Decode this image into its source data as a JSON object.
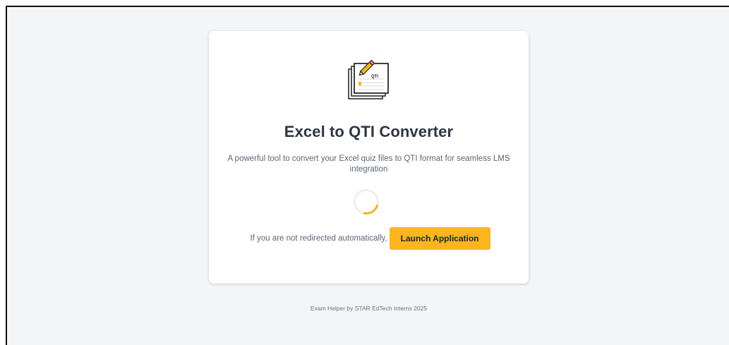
{
  "app": {
    "title": "Excel to QTI Converter",
    "subtitle": "A powerful tool to convert your Excel quiz files to QTI format for seamless LMS integration",
    "logo_icon": "qti-document-stack-icon",
    "logo_label": "QTI"
  },
  "redirect": {
    "message": "If you are not redirected automatically,",
    "button_label": "Launch Application"
  },
  "loading": {
    "spinner_icon": "loading-spinner-icon"
  },
  "footer": {
    "text": "Exam Helper by STAR EdTech Interns 2025"
  },
  "colors": {
    "accent": "#fbb51f",
    "title": "#2d3644",
    "body_text": "#5c6675",
    "background": "#f4f5f7",
    "card": "#ffffff"
  }
}
